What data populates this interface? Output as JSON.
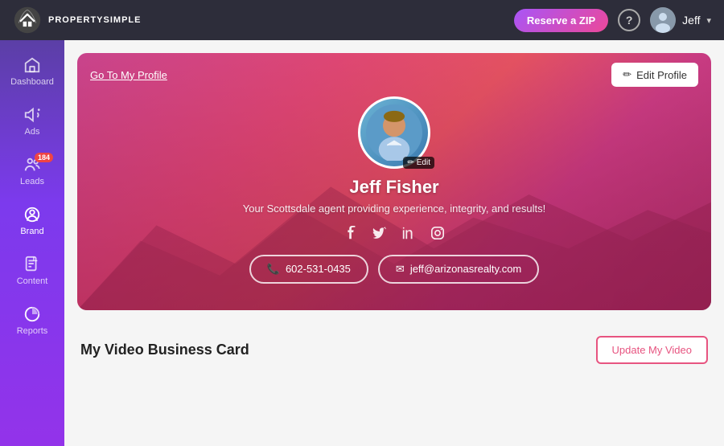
{
  "topnav": {
    "logo_text": "PROPERTYSIMPLE",
    "reserve_btn_label": "Reserve a ZIP",
    "help_label": "?",
    "user_name": "Jeff",
    "chevron": "▾"
  },
  "sidebar": {
    "items": [
      {
        "id": "dashboard",
        "label": "Dashboard",
        "icon": "home"
      },
      {
        "id": "ads",
        "label": "Ads",
        "icon": "megaphone"
      },
      {
        "id": "leads",
        "label": "Leads",
        "icon": "people",
        "badge": "184"
      },
      {
        "id": "brand",
        "label": "Brand",
        "icon": "user-circle",
        "active": true
      },
      {
        "id": "content",
        "label": "Content",
        "icon": "document"
      },
      {
        "id": "reports",
        "label": "Reports",
        "icon": "chart"
      }
    ]
  },
  "profile_hero": {
    "go_to_profile": "Go To My Profile",
    "edit_profile_btn": "Edit Profile",
    "edit_icon": "✏",
    "name": "Jeff Fisher",
    "tagline": "Your Scottsdale agent providing experience, integrity, and results!",
    "social": {
      "facebook": "f",
      "twitter": "t",
      "linkedin": "in",
      "instagram": "📷"
    },
    "phone": "602-531-0435",
    "email": "jeff@arizonasrealty.com",
    "avatar_edit_label": "Edit"
  },
  "video_section": {
    "title": "My Video Business Card",
    "update_btn": "Update My Video"
  }
}
